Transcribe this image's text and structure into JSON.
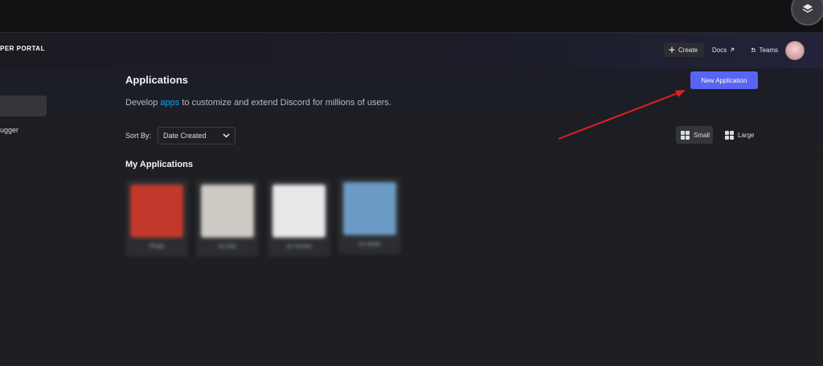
{
  "header": {
    "logo": "PER PORTAL",
    "create_label": "Create",
    "docs_label": "Docs",
    "teams_label": "Teams"
  },
  "sidebar": {
    "fragment_label": "ugger"
  },
  "main": {
    "title": "Applications",
    "subtitle_pre": "Develop ",
    "subtitle_link": "apps",
    "subtitle_post": " to customize and extend Discord for millions of users.",
    "new_app_label": "New Application",
    "sort_label": "Sort By:",
    "sort_value": "Date Created",
    "view_small_label": "Small",
    "view_large_label": "Large",
    "section_title": "My Applications",
    "apps": [
      {
        "name": "Phobi",
        "thumb_color": "#c2392b"
      },
      {
        "name": "on Ichy",
        "thumb_color": "#cfc9c3"
      },
      {
        "name": "on Yorrow",
        "thumb_color": "#e8e8e8"
      },
      {
        "name": "on serae",
        "thumb_color": "#6b9ac4"
      }
    ]
  },
  "colors": {
    "accent": "#5865f2",
    "link": "#00a8fc",
    "annotation_arrow": "#e0201c"
  },
  "icons": [
    "layers-icon",
    "plus-icon",
    "external-link-icon",
    "teams-icon",
    "chevron-down-icon",
    "grid-small-icon",
    "grid-large-icon"
  ]
}
